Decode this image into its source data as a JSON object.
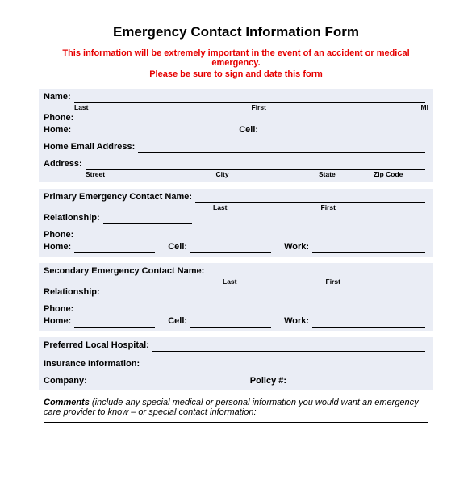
{
  "title": "Emergency Contact Information Form",
  "warn_line1": "This information will be extremely important in the event of an accident or medical emergency.",
  "warn_line2": "Please be sure to sign and date this form",
  "labels": {
    "name": "Name:",
    "last": "Last",
    "first": "First",
    "mi": "MI",
    "phone": "Phone:",
    "home": "Home:",
    "cell": "Cell:",
    "work": "Work:",
    "home_email": "Home Email Address:",
    "address": "Address:",
    "street": "Street",
    "city": "City",
    "state": "State",
    "zip": "Zip Code",
    "primary_contact": "Primary Emergency Contact Name",
    "relationship": "Relationship:",
    "secondary_contact": "Secondary Emergency Contact Name",
    "preferred_hospital": "Preferred Local Hospital:",
    "insurance_info": "Insurance Information:",
    "company": "Company:",
    "policy": "Policy #:"
  },
  "comments_label": "Comments",
  "comments_text": " (include any special medical or personal information you would want an emergency care provider to know – or special contact information:"
}
